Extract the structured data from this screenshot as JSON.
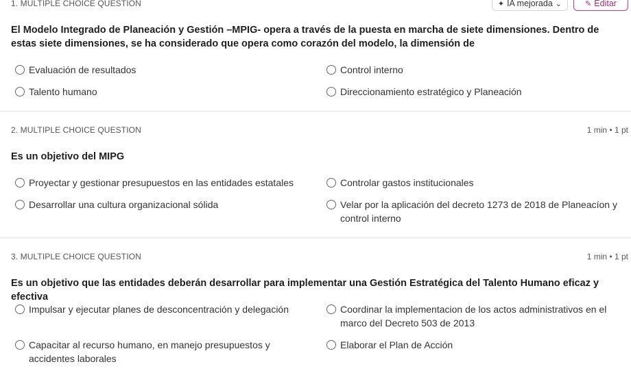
{
  "toolbar": {
    "ai_label": "IA mejorada",
    "edit_label": "Editar"
  },
  "questions": [
    {
      "header": "1. MULTIPLE CHOICE QUESTION",
      "meta": "",
      "text": "El Modelo Integrado de Planeación y Gestión –MPIG- opera a través de la puesta en marcha de siete dimensiones. Dentro de estas siete dimensiones, se ha considerado que opera como corazón del modelo, la dimensión de",
      "options": [
        "Evaluación de resultados",
        "Control interno",
        "Talento humano",
        "Direccionamiento estratégico y Planeación"
      ]
    },
    {
      "header": "2. MULTIPLE CHOICE QUESTION",
      "meta": "1 min • 1 pt",
      "text": "Es un objetivo del MIPG",
      "options": [
        "Proyectar y gestionar presupuestos en las entidades estatales",
        "Controlar gastos institucionales",
        "Desarrollar una cultura organizacional sólida",
        "Velar por la aplicación del decreto 1273 de 2018 de Planeacíon y control interno"
      ]
    },
    {
      "header": "3. MULTIPLE CHOICE QUESTION",
      "meta": "1 min • 1 pt",
      "text": "Es un objetivo que las entidades deberán desarrollar para implementar una Gestión Estratégica del Talento Humano eficaz y efectiva",
      "options": [
        "Impulsar y ejecutar planes de desconcentración y delegación",
        "Coordinar la implementacion de los actos administrativos en el marco del Decreto 503 de 2013",
        "Capacitar al recurso humano, en manejo presupuestos y accidentes laborales",
        "Elaborar el Plan de Acción"
      ]
    }
  ]
}
